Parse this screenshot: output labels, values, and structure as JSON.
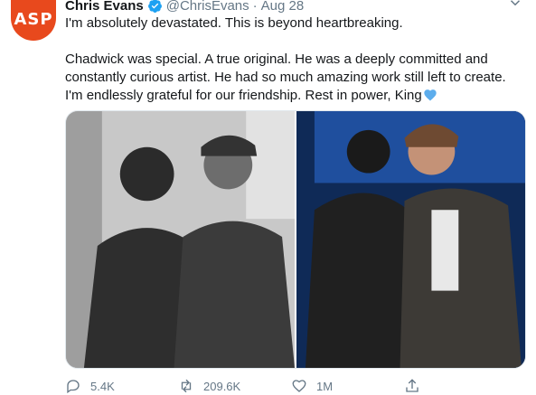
{
  "tweet": {
    "avatar_text": "ASP",
    "name": "Chris Evans",
    "handle": "@ChrisEvans",
    "separator": "·",
    "date": "Aug 28",
    "line1": "I'm absolutely devastated. This is beyond heartbreaking.",
    "body": "Chadwick was special. A true original. He was a deeply committed and constantly curious artist. He had so much amazing work still left to create. I'm endlessly grateful for our friendship. Rest in power, King",
    "stats": {
      "replies": "5.4K",
      "retweets": "209.6K",
      "likes": "1M"
    }
  },
  "colors": {
    "brand": "#1da1f2",
    "avatar": "#e8491d",
    "secondary_text": "#657786"
  },
  "icons": [
    "verified-badge-icon",
    "chevron-down-icon",
    "blue-heart-icon",
    "reply-icon",
    "retweet-icon",
    "like-icon",
    "share-icon"
  ]
}
